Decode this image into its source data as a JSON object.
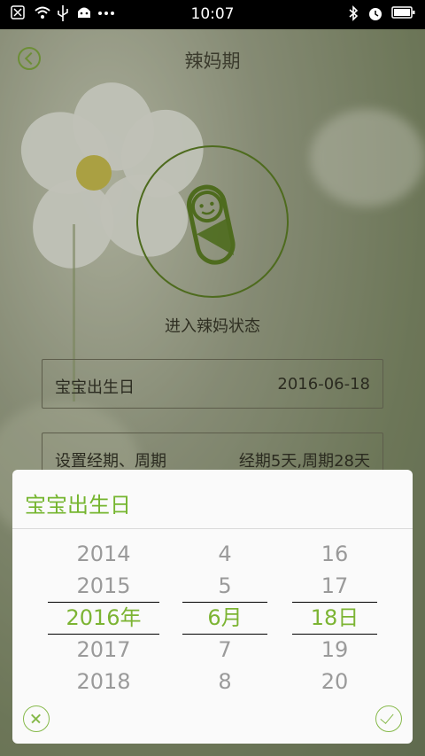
{
  "status_bar": {
    "time": "10:07"
  },
  "header": {
    "title": "辣妈期"
  },
  "main": {
    "enter_label": "进入辣妈状态",
    "rows": [
      {
        "label": "宝宝出生日",
        "value": "2016-06-18"
      },
      {
        "label": "设置经期、周期",
        "value": "经期5天,周期28天"
      }
    ]
  },
  "dialog": {
    "title": "宝宝出生日",
    "year": [
      "2014",
      "2015",
      "2016年",
      "2017",
      "2018"
    ],
    "month": [
      "4",
      "5",
      "6月",
      "7",
      "8"
    ],
    "day": [
      "16",
      "17",
      "18日",
      "19",
      "20"
    ]
  },
  "colors": {
    "accent": "#7cb433",
    "circle": "#4e6b1e"
  }
}
